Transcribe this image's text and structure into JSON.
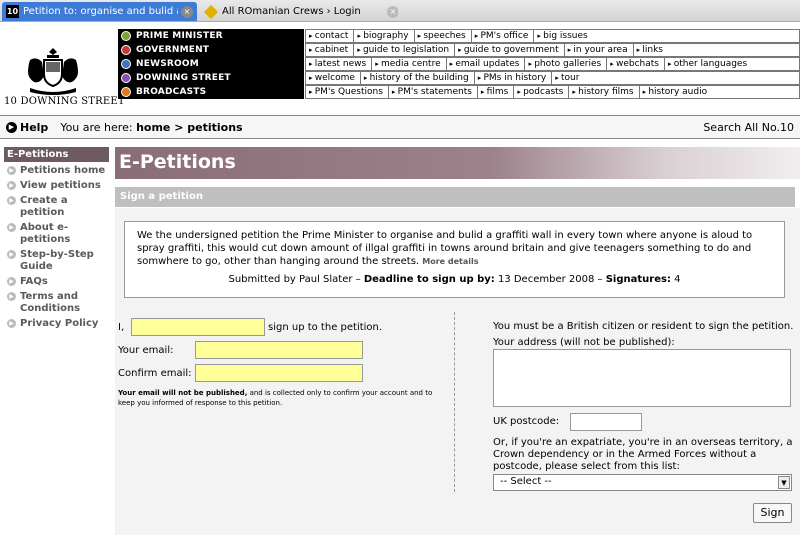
{
  "tabs": [
    {
      "favicon": "10",
      "title": "Petition to: organise and bulid a gr..."
    },
    {
      "favicon": "yellow-diamond-icon",
      "title": "All ROmanian Crews › Login"
    }
  ],
  "brand": "10 DOWNING STREET",
  "topnav": [
    {
      "label": "PRIME MINISTER",
      "color": "#7aa33a",
      "links": [
        "contact",
        "biography",
        "speeches",
        "PM's office",
        "big issues"
      ]
    },
    {
      "label": "GOVERNMENT",
      "color": "#c33b3b",
      "links": [
        "cabinet",
        "guide to legislation",
        "guide to government",
        "in your area",
        "links"
      ]
    },
    {
      "label": "NEWSROOM",
      "color": "#3b74c3",
      "links": [
        "latest news",
        "media centre",
        "email updates",
        "photo galleries",
        "webchats",
        "other languages"
      ]
    },
    {
      "label": "DOWNING STREET",
      "color": "#8a4fb3",
      "links": [
        "welcome",
        "history of the building",
        "PMs in history",
        "tour"
      ]
    },
    {
      "label": "BROADCASTS",
      "color": "#e07a1f",
      "links": [
        "PM's Questions",
        "PM's statements",
        "films",
        "podcasts",
        "history films",
        "history audio"
      ]
    }
  ],
  "utility": {
    "help": "Help",
    "you_are_here": "You are here:",
    "crumb_home": "home",
    "crumb_sep": " > ",
    "crumb_current": "petitions",
    "search": "Search All No.10"
  },
  "sidebar": {
    "heading": "E-Petitions",
    "items": [
      "Petitions home",
      "View petitions",
      "Create a petition",
      "About e-petitions",
      "Step-by-Step Guide",
      "FAQs",
      "Terms and Conditions",
      "Privacy Policy"
    ]
  },
  "banner_title": "E-Petitions",
  "section_title": "Sign a petition",
  "petition": {
    "text": "We the undersigned petition the Prime Minister to organise and bulid a graffiti wall in every town where anyone is aloud to spray graffiti, this would cut down amount of illgal graffiti in towns around britain and give teenagers something to do and somwhere to go, other than hanging around the streets.",
    "more": "More details",
    "submitted_by": "Submitted by Paul Slater",
    "deadline_label": "Deadline to sign up by:",
    "deadline": "13 December 2008",
    "signatures_label": "Signatures:",
    "signatures": "4"
  },
  "form": {
    "i_label": "I,",
    "signup_text": "sign up to the petition.",
    "email_label": "Your email:",
    "confirm_label": "Confirm email:",
    "note_bold": "Your email will not be published,",
    "note_rest": " and is collected only to confirm your account and to keep you informed of response to this petition.",
    "citizen_note": "You must be a British citizen or resident to sign the petition.",
    "address_label": "Your address (will not be published):",
    "postcode_label": "UK postcode:",
    "expat_note": "Or, if you're an expatriate, you're in an overseas territory, a Crown dependency or in the Armed Forces without a postcode, please select from this list:",
    "select_value": "-- Select --",
    "submit": "Sign"
  }
}
